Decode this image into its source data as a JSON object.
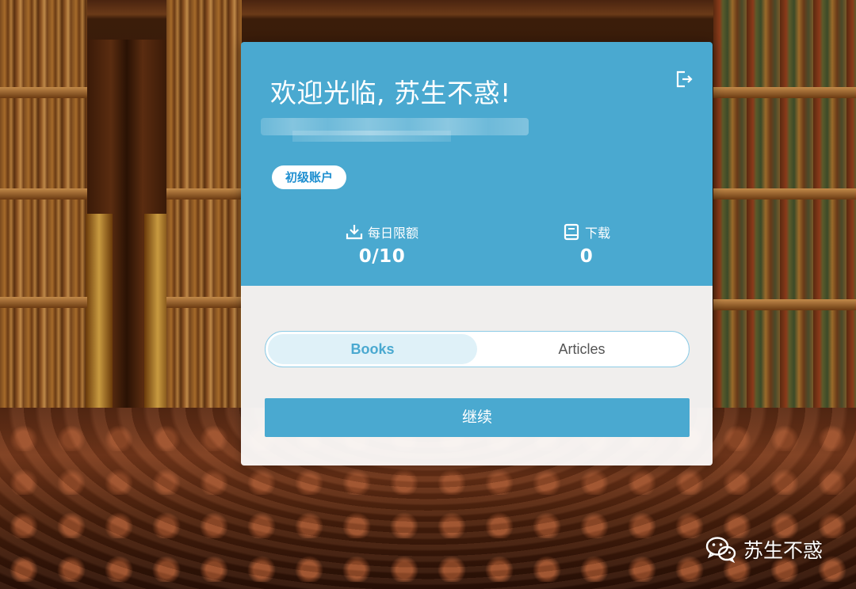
{
  "header": {
    "welcome_title": "欢迎光临, 苏生不惑!",
    "account_badge": "初级账户"
  },
  "stats": {
    "daily_quota": {
      "label": "每日限额",
      "value": "0/10",
      "icon": "download-icon"
    },
    "downloads": {
      "label": "下载",
      "value": "0",
      "icon": "book-icon"
    }
  },
  "tabs": [
    {
      "label": "Books",
      "active": true
    },
    {
      "label": "Articles",
      "active": false
    }
  ],
  "actions": {
    "continue_label": "继续",
    "logout_icon": "logout-icon"
  },
  "watermark": {
    "text": "苏生不惑",
    "icon": "wechat-icon"
  },
  "colors": {
    "accent": "#4aa9d0",
    "badge_text": "#1f8fd0",
    "active_tab_bg": "#dff1f8"
  }
}
